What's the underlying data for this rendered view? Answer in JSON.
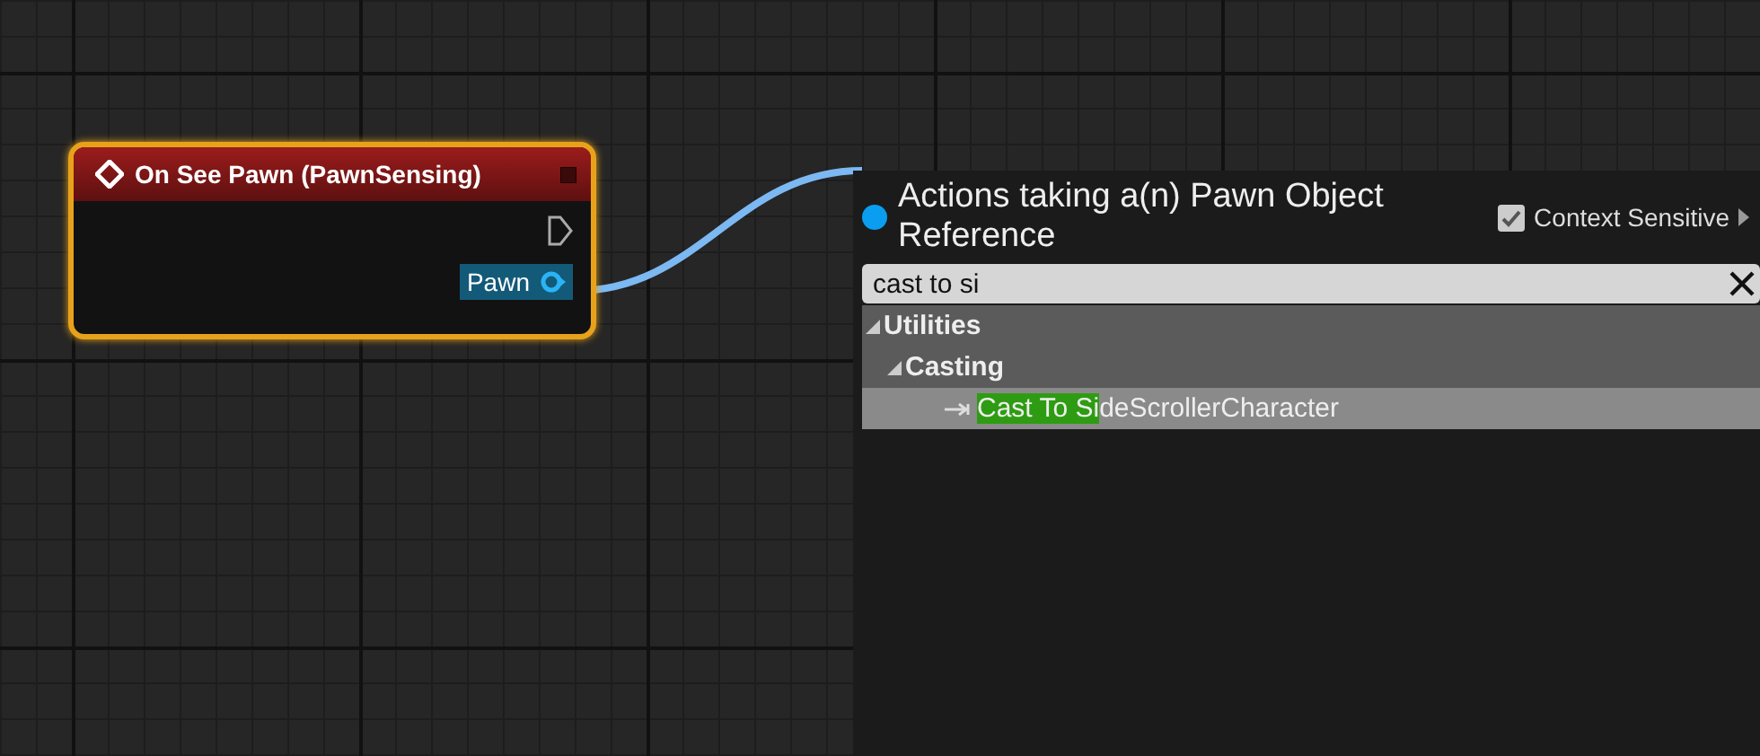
{
  "node": {
    "title": "On See Pawn (PawnSensing)",
    "pins": [
      {
        "kind": "exec"
      },
      {
        "kind": "object",
        "label": "Pawn",
        "selected": true
      }
    ]
  },
  "action_menu": {
    "title": "Actions taking a(n) Pawn Object Reference",
    "context_sensitive": {
      "label": "Context Sensitive",
      "checked": true
    },
    "search": {
      "value": "cast to si"
    },
    "tree": [
      {
        "label": "Utilities",
        "expanded": true,
        "children": [
          {
            "label": "Casting",
            "expanded": true,
            "children": [
              {
                "match": "Cast To Si",
                "rest": "deScrollerCharacter",
                "selected": true
              }
            ]
          }
        ]
      }
    ]
  }
}
